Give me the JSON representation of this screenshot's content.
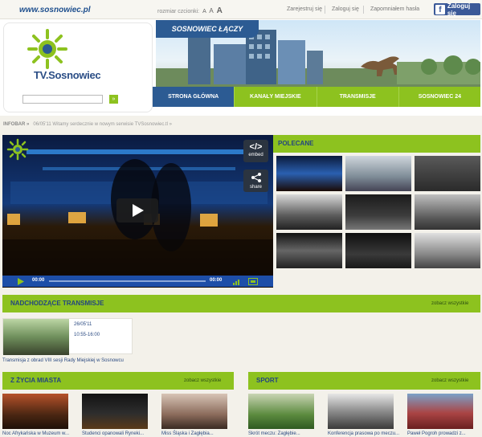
{
  "topbar": {
    "site_url": "www.sosnowiec.pl",
    "font_size_label": "rozmiar czcionki:",
    "font_size_options": [
      "A",
      "A",
      "A"
    ],
    "links": [
      "Zarejestruj się",
      "Zaloguj się",
      "Zapomniałem hasła"
    ],
    "facebook_button": "Zaloguj się"
  },
  "header": {
    "logo_text": "TV.Sosnowiec",
    "tagline": "SOSNOWIEC ŁĄCZY",
    "search_button": "»"
  },
  "nav": {
    "items": [
      "STRONA GŁÓWNA",
      "KANAŁY MIEJSKIE",
      "TRANSMISJE",
      "SOSNOWIEC 24"
    ],
    "active_index": 0
  },
  "infobar": {
    "label": "INFOBAR »",
    "text": "06/05'11 Witamy serdecznie w nowym serwisie TVSosnowiec.tl »"
  },
  "player": {
    "embed_label": "embed",
    "share_label": "share",
    "time_current": "00:00",
    "time_total": "00:00"
  },
  "polecane": {
    "title": "POLECANE"
  },
  "upcoming": {
    "title": "NADCHODZĄCE TRANSMISJE",
    "see_all": "zobacz wszystkie",
    "item": {
      "date": "26/05'11",
      "time": "10:55-16:00",
      "caption": "Transmisja z obrad VIII sesji Rady Miejskiej w Sosnowcu"
    }
  },
  "city_life": {
    "title": "Z ŻYCIA MIASTA",
    "see_all": "zobacz wszystkie",
    "captions": [
      "Noc Afrykańska w Muzeum w...",
      "Studenci opanowali Ryneki...",
      "Miss Śląska i Zagłębia..."
    ]
  },
  "sport": {
    "title": "SPORT",
    "see_all": "zobacz wszystkie",
    "captions": [
      "Skrót meczu: Zagłębie...",
      "Konferencja prasowa po meczu...",
      "Paweł Pogroh prowadzi z..."
    ]
  },
  "colors": {
    "brand_green": "#8dc21f",
    "brand_blue": "#2c5b93",
    "facebook": "#3b5998"
  }
}
